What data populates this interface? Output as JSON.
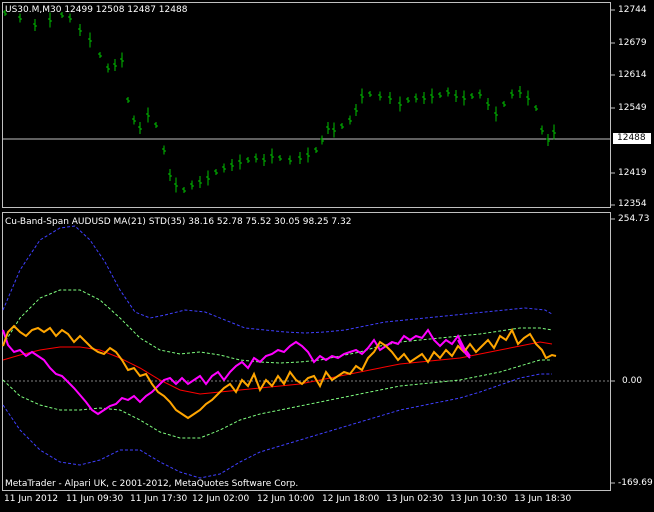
{
  "main": {
    "title": "US30.M,M30  12499 12508 12487 12488",
    "y_labels": [
      "12744",
      "12679",
      "12614",
      "12549",
      "12419",
      "12354"
    ],
    "current_price": "12488"
  },
  "indicator": {
    "title": "Cu-Band-Span AUDUSD  MA(21) STD(35)  38.16 52.78 75.52 30.05 98.25 7.32",
    "y_top": "254.73",
    "y_zero": "0.00",
    "y_bottom": "-169.69",
    "copyright": "MetaTrader - Alpari UK, c 2001-2012, MetaQuotes Software Corp."
  },
  "x_labels": [
    "11 Jun 2012",
    "11 Jun 09:30",
    "11 Jun 17:30",
    "12 Jun 02:00",
    "12 Jun 10:00",
    "12 Jun 18:00",
    "13 Jun 02:30",
    "13 Jun 10:30",
    "13 Jun 18:30"
  ],
  "colors": {
    "candles": "#00c000",
    "indicator_main": "#ff00ff",
    "indicator_orange": "#ffa500",
    "ma_red": "#ff0000",
    "band_inner": "#7fff7f",
    "band_outer": "#3f3fff",
    "grid_line": "#c0c0c0"
  }
}
